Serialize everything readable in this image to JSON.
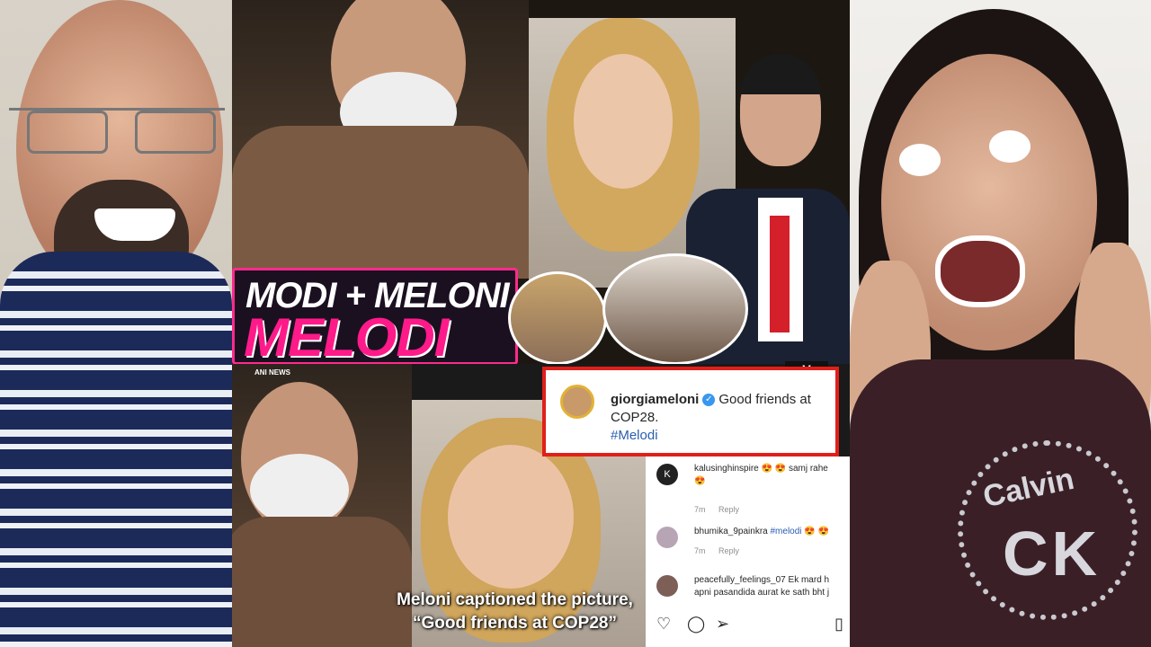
{
  "video": {
    "badge_top": "MODI + MELONI",
    "badge_main": "MELODI",
    "source_label": "ANI NEWS",
    "subtitle_line1": "Meloni captioned the picture,",
    "subtitle_line2": "“Good friends at COP28”"
  },
  "instagram_post": {
    "username": "giorgiameloni",
    "caption_part1": "Good friends at",
    "caption_part2": "COP28.",
    "hashtag": "#Melodi"
  },
  "comments": [
    {
      "avatar_letter": "K",
      "username": "kalusinghinspire",
      "text": "😍 😍 samj rahe",
      "text2": "😍",
      "time": "7m",
      "reply": "Reply"
    },
    {
      "username": "bhumika_9painkra",
      "tag": "#melodi",
      "text": "😍 😍",
      "time": "7m",
      "reply": "Reply"
    },
    {
      "username": "peacefully_feelings_07",
      "text": "Ek mard h",
      "text2": "apni pasandida aurat ke sath bht j"
    }
  ],
  "logo_text": "V"
}
